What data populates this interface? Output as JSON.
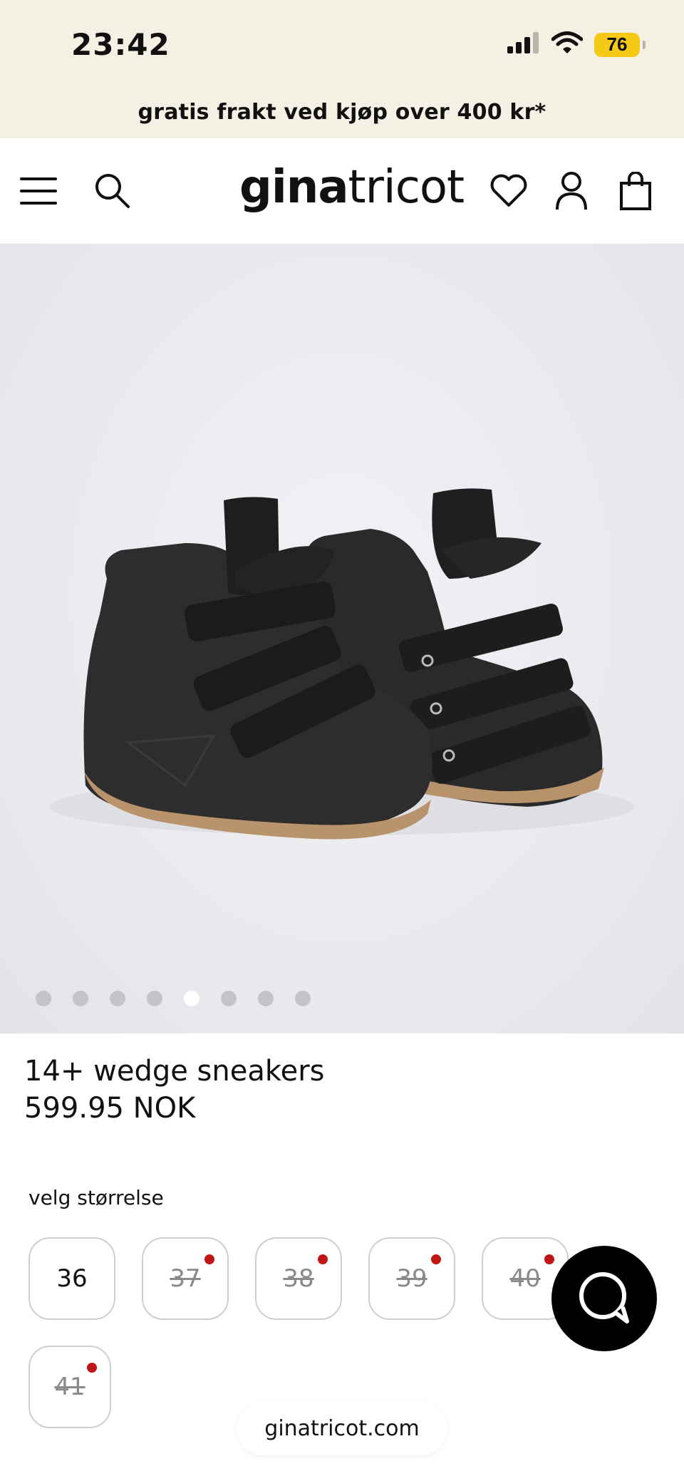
{
  "status_bar": {
    "time": "23:42",
    "battery": "76",
    "icons": [
      "cellular-signal-icon",
      "wifi-icon",
      "battery-icon"
    ]
  },
  "promo": {
    "text": "gratis frakt ved kjøp over 400 kr*"
  },
  "header": {
    "logo_bold": "gina",
    "logo_light": "tricot",
    "icons": [
      "menu-icon",
      "search-icon",
      "heart-icon",
      "account-icon",
      "bag-icon"
    ]
  },
  "gallery": {
    "image_count": 8,
    "active_index": 4
  },
  "product": {
    "name": "14+ wedge sneakers",
    "price": "599.95 NOK"
  },
  "sizes": {
    "label": "velg størrelse",
    "options": [
      {
        "size": "36",
        "available": true
      },
      {
        "size": "37",
        "available": false
      },
      {
        "size": "38",
        "available": false
      },
      {
        "size": "39",
        "available": false
      },
      {
        "size": "40",
        "available": false
      },
      {
        "size": "41",
        "available": false
      }
    ]
  },
  "browser": {
    "url": "ginatricot.com"
  },
  "colors": {
    "promo_bg": "#f5f0e4",
    "battery": "#f5c914",
    "sold_out_dot": "#c01616"
  }
}
